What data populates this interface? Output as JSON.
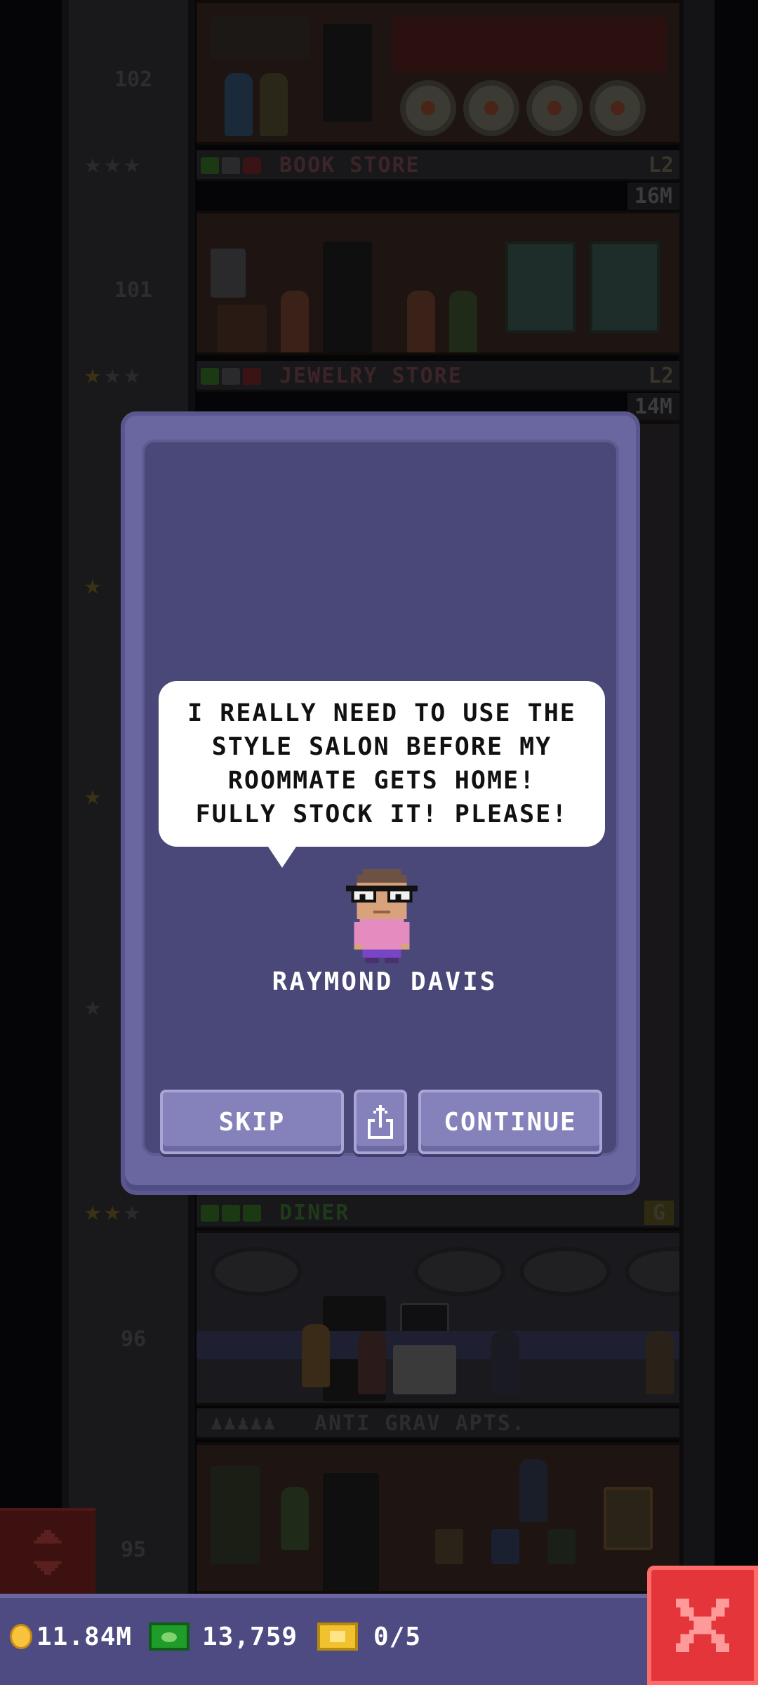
{
  "floors": [
    {
      "number": "102",
      "name": "",
      "level": "",
      "stars_filled": 0,
      "money": ""
    },
    {
      "number": "",
      "name": "BOOK STORE",
      "level": "L2",
      "stars_filled": 0,
      "money": "16M",
      "name_color": "#3c2428"
    },
    {
      "number": "101",
      "name": "",
      "level": "",
      "stars_filled": 0,
      "money": ""
    },
    {
      "number": "",
      "name": "JEWELRY STORE",
      "level": "L2",
      "stars_filled": 1,
      "money": "14M",
      "name_color": "#3c2428"
    },
    {
      "number": "",
      "name": "DINER",
      "level": "G",
      "stars_filled": 2,
      "money": "",
      "name_color": "#1f3a1a"
    },
    {
      "number": "96",
      "name": "",
      "level": "",
      "stars_filled": 0,
      "money": ""
    },
    {
      "number": "",
      "name": "ANTI GRAV APTS.",
      "level": "",
      "stars_filled": 0,
      "money": "",
      "name_color": "#2c2c30"
    },
    {
      "number": "95",
      "name": "",
      "level": "",
      "stars_filled": 0,
      "money": ""
    }
  ],
  "dialog": {
    "message": "I REALLY NEED TO USE THE\nSTYLE SALON BEFORE MY\nROOMMATE GETS HOME!\nFULLY STOCK IT! PLEASE!",
    "character_name": "RAYMOND DAVIS",
    "skip_label": "SKIP",
    "share_icon": "share-icon",
    "continue_label": "CONTINUE"
  },
  "status": {
    "coins": "11.84M",
    "bux": "13,759",
    "tickets": "0/5"
  },
  "colors": {
    "dialog_bg": "#4a4878",
    "dialog_frame": "#6a66a0",
    "button": "#8581ba",
    "close_button": "#e4363a",
    "status_bar": "#4e4a82"
  }
}
